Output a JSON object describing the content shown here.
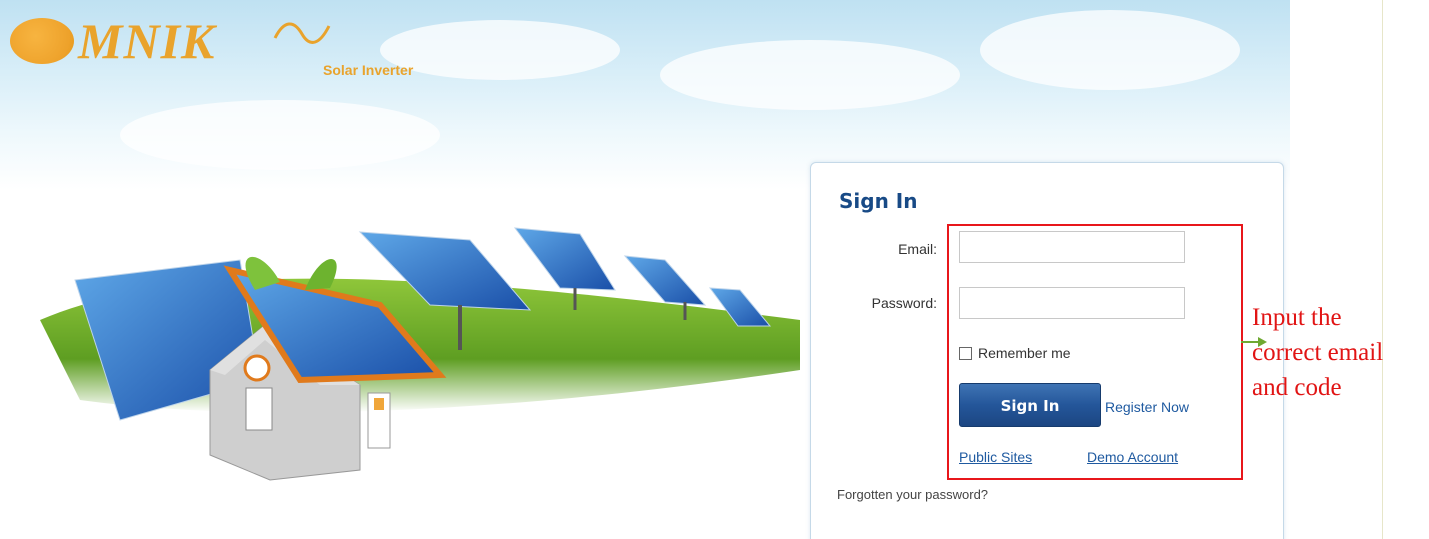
{
  "logo": {
    "brand_text": "MNIK",
    "subtitle": "Solar Inverter"
  },
  "login": {
    "title": "Sign In",
    "email_label": "Email:",
    "email_value": "",
    "password_label": "Password:",
    "password_value": "",
    "remember_label": "Remember me",
    "remember_checked": false,
    "signin_button": "Sign In",
    "register_link": "Register Now",
    "public_sites_link": "Public Sites",
    "demo_account_link": "Demo Account",
    "forgot_link": "Forgotten your password?"
  },
  "annotation": {
    "line1": "Input the",
    "line2": "correct email",
    "line3": "and code",
    "color": "#e11414"
  },
  "colors": {
    "brand_orange": "#e9a32c",
    "title_blue": "#184a86",
    "link_blue": "#1f5aa0",
    "button_blue": "#24569a"
  }
}
